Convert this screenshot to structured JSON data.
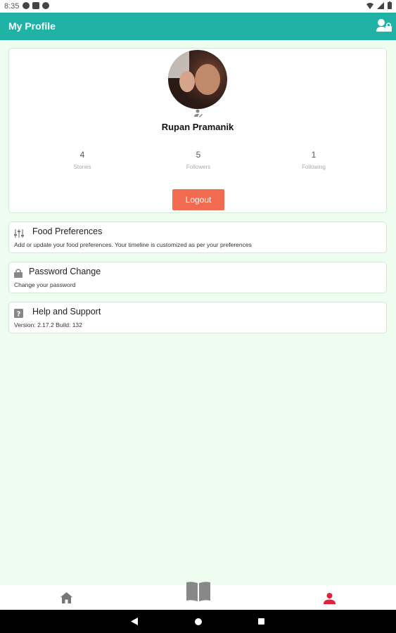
{
  "status_bar": {
    "time": "8:35"
  },
  "appbar": {
    "title": "My Profile",
    "account_icon": "account-lock-icon"
  },
  "profile": {
    "name": "Rupan Pramanik",
    "stats": [
      {
        "value": "4",
        "label": "Stories"
      },
      {
        "value": "5",
        "label": "Followers"
      },
      {
        "value": "1",
        "label": "Following"
      }
    ],
    "logout_label": "Logout"
  },
  "options": [
    {
      "title": "Food Preferences",
      "subtitle": "Add or update your food preferences. Your timeline is customized as per your preferences",
      "icon": "sliders-icon"
    },
    {
      "title": "Password Change",
      "subtitle": "Change your password",
      "icon": "lock-icon"
    },
    {
      "title": "Help and Support",
      "subtitle": "Version: 2.17.2 Build: 132",
      "icon": "help-icon"
    }
  ],
  "bottom_nav": {
    "items": [
      "home-icon",
      "book-icon",
      "profile-icon"
    ],
    "active": "profile",
    "active_color": "#e0213c"
  },
  "colors": {
    "appbar": "#20b2a5",
    "logout": "#f26a4f",
    "background": "#eefdf0"
  }
}
